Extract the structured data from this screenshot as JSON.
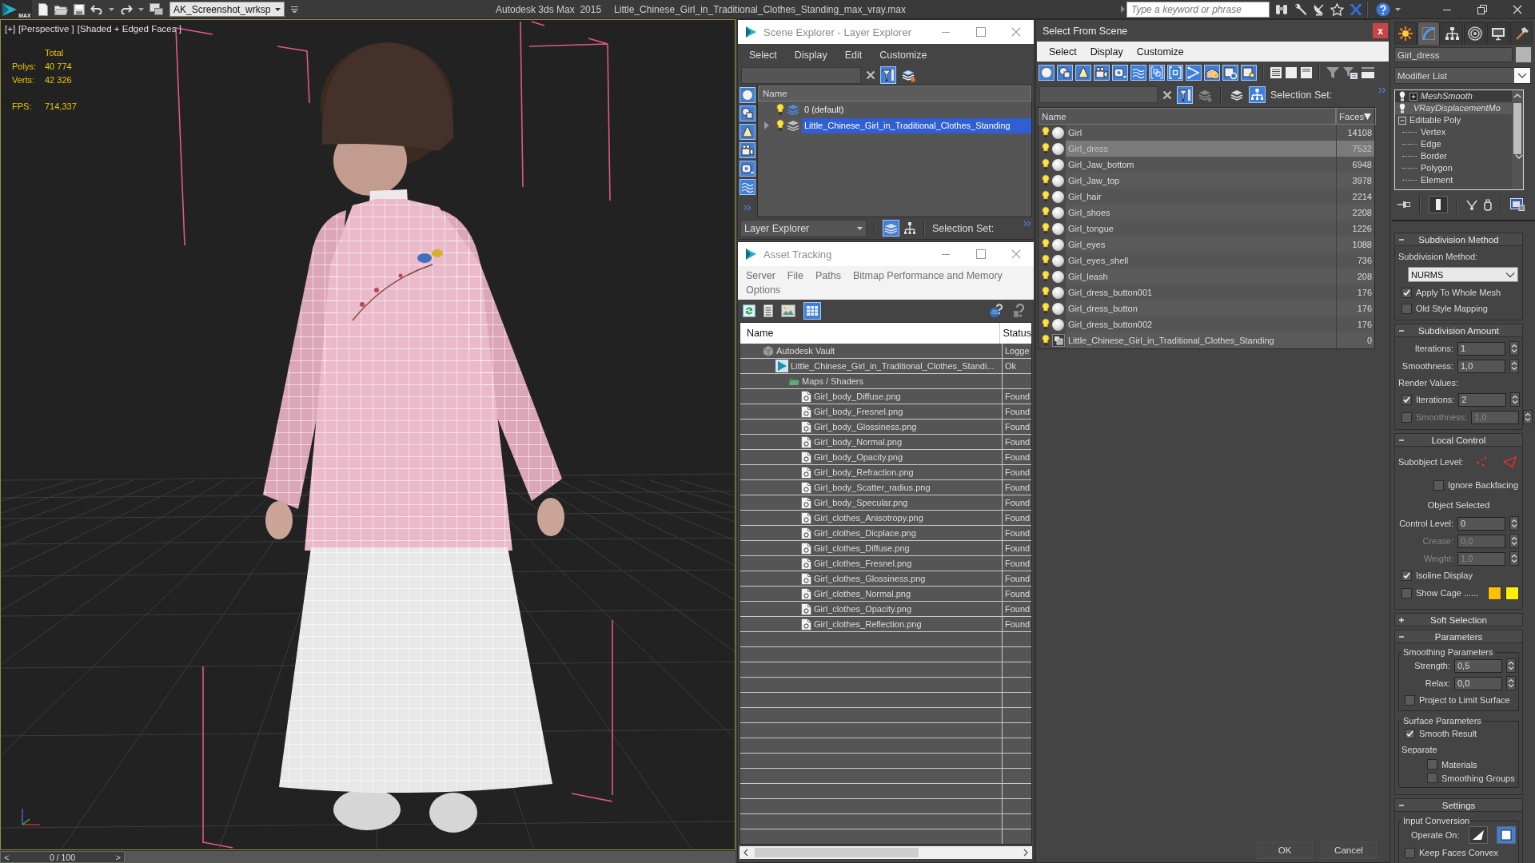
{
  "app_bar": {
    "logo": "MAX",
    "workspace": "AK_Screenshot_wrksp",
    "title": "Autodesk 3ds Max  2015",
    "file": "Little_Chinese_Girl_in_Traditional_Clothes_Standing_max_vray.max",
    "search": {
      "placeholder": "Type a keyword or phrase"
    }
  },
  "viewport": {
    "labels": [
      "[+]",
      "[Perspective ]",
      "[Shaded + Edged Faces ]"
    ],
    "stats_heading": "Total",
    "stats": [
      {
        "label": "Polys:",
        "value": "40 774"
      },
      {
        "label": "Verts:",
        "value": "42 326"
      },
      {
        "label": "FPS:",
        "value": "714,337"
      }
    ]
  },
  "time_slider": {
    "previous": "<",
    "position": "0 / 100",
    "next": ">",
    "level": 0
  },
  "scene_explorer": {
    "title": "Scene Explorer - Layer Explorer",
    "menu": [
      "Select",
      "Display",
      "Edit",
      "Customize"
    ],
    "type_filters": [
      {
        "kind": "sphere",
        "on": true
      },
      {
        "kind": "shapes",
        "on": true
      },
      {
        "kind": "spotlight",
        "on": true
      },
      {
        "kind": "camera",
        "on": true
      },
      {
        "kind": "tape",
        "on": true
      },
      {
        "kind": "waves",
        "on": true
      }
    ],
    "column": "Name",
    "layers": [
      {
        "name": "0 (default)",
        "current": true,
        "expandable": false,
        "selected": false
      },
      {
        "name": "Little_Chinese_Girl_in_Traditional_Clothes_Standing",
        "current": false,
        "expandable": true,
        "selected": true
      }
    ],
    "explorer": "Layer Explorer",
    "selection_set": "Selection Set:"
  },
  "asset_tracking": {
    "title": "Asset Tracking",
    "menu": [
      "Server",
      "File",
      "Paths",
      "Bitmap Performance and Memory",
      "Options"
    ],
    "columns": [
      "Name",
      "Status"
    ],
    "tree": [
      {
        "kind": "vault",
        "name": "Autodesk Vault",
        "status": "Logge",
        "children": [
          {
            "kind": "scene",
            "name": "Little_Chinese_Girl_in_Traditional_Clothes_Standi...",
            "status": "Ok",
            "children": [
              {
                "kind": "folder",
                "name": "Maps / Shaders",
                "children": [
                  {
                    "kind": "bitmap",
                    "name": "Girl_body_Diffuse.png",
                    "status": "Found"
                  },
                  {
                    "kind": "bitmap",
                    "name": "Girl_body_Fresnel.png",
                    "status": "Found"
                  },
                  {
                    "kind": "bitmap",
                    "name": "Girl_body_Glossiness.png",
                    "status": "Found"
                  },
                  {
                    "kind": "bitmap",
                    "name": "Girl_body_Normal.png",
                    "status": "Found"
                  },
                  {
                    "kind": "bitmap",
                    "name": "Girl_body_Opacity.png",
                    "status": "Found"
                  },
                  {
                    "kind": "bitmap",
                    "name": "Girl_body_Refraction.png",
                    "status": "Found"
                  },
                  {
                    "kind": "bitmap",
                    "name": "Girl_body_Scatter_radius.png",
                    "status": "Found"
                  },
                  {
                    "kind": "bitmap",
                    "name": "Girl_body_Specular.png",
                    "status": "Found"
                  },
                  {
                    "kind": "bitmap",
                    "name": "Girl_clothes_Anisotropy.png",
                    "status": "Found"
                  },
                  {
                    "kind": "bitmap",
                    "name": "Girl_clothes_Dicplace.png",
                    "status": "Found"
                  },
                  {
                    "kind": "bitmap",
                    "name": "Girl_clothes_Diffuse.png",
                    "status": "Found"
                  },
                  {
                    "kind": "bitmap",
                    "name": "Girl_clothes_Fresnel.png",
                    "status": "Found"
                  },
                  {
                    "kind": "bitmap",
                    "name": "Girl_clothes_Glossiness.png",
                    "status": "Found"
                  },
                  {
                    "kind": "bitmap",
                    "name": "Girl_clothes_Normal.png",
                    "status": "Found"
                  },
                  {
                    "kind": "bitmap",
                    "name": "Girl_clothes_Opacity.png",
                    "status": "Found"
                  },
                  {
                    "kind": "bitmap",
                    "name": "Girl_clothes_Reflection.png",
                    "status": "Found"
                  }
                ]
              }
            ]
          }
        ]
      }
    ]
  },
  "select_from_scene": {
    "title": "Select From Scene",
    "close": "x",
    "menu": [
      "Select",
      "Display",
      "Customize"
    ],
    "type_filters": [
      {
        "kind": "sphere",
        "on": true
      },
      {
        "kind": "shapes",
        "on": true
      },
      {
        "kind": "spotlight",
        "on": true
      },
      {
        "kind": "camera",
        "on": true
      },
      {
        "kind": "tape",
        "on": true
      },
      {
        "kind": "waves",
        "on": true
      },
      {
        "kind": "squares",
        "on": true
      },
      {
        "kind": "bracket",
        "on": true
      },
      {
        "kind": "bone",
        "on": true
      },
      {
        "kind": "box_sun",
        "on": true
      },
      {
        "kind": "box_gear",
        "on": true
      },
      {
        "kind": "box_bulb",
        "on": true
      }
    ],
    "selection_set": "Selection Set:",
    "columns": [
      "Name",
      "Faces"
    ],
    "objects": [
      {
        "kind": "geometry",
        "name": "Girl",
        "faces": "14108",
        "selected": false
      },
      {
        "kind": "geometry",
        "name": "Girl_dress",
        "faces": "7532",
        "selected": true
      },
      {
        "kind": "geometry",
        "name": "Girl_Jaw_bottom",
        "faces": "6948",
        "selected": false
      },
      {
        "kind": "geometry",
        "name": "Girl_Jaw_top",
        "faces": "3978",
        "selected": false
      },
      {
        "kind": "geometry",
        "name": "Girl_hair",
        "faces": "2214",
        "selected": false
      },
      {
        "kind": "geometry",
        "name": "Girl_shoes",
        "faces": "2208",
        "selected": false
      },
      {
        "kind": "geometry",
        "name": "Girl_tongue",
        "faces": "1226",
        "selected": false
      },
      {
        "kind": "geometry",
        "name": "Girl_eyes",
        "faces": "1088",
        "selected": false
      },
      {
        "kind": "geometry",
        "name": "Girl_eyes_shell",
        "faces": "736",
        "selected": false
      },
      {
        "kind": "geometry",
        "name": "Girl_leash",
        "faces": "208",
        "selected": false
      },
      {
        "kind": "geometry",
        "name": "Girl_dress_button001",
        "faces": "176",
        "selected": false
      },
      {
        "kind": "geometry",
        "name": "Girl_dress_button",
        "faces": "176",
        "selected": false
      },
      {
        "kind": "geometry",
        "name": "Girl_dress_button002",
        "faces": "176",
        "selected": false
      },
      {
        "kind": "group",
        "name": "Little_Chinese_Girl_in_Traditional_Clothes_Standing",
        "faces": "0",
        "selected": false
      }
    ],
    "buttons": [
      "OK",
      "Cancel"
    ]
  },
  "command_panel": {
    "tabs": [
      {
        "kind": "create",
        "selected": false
      },
      {
        "kind": "modify",
        "selected": true
      },
      {
        "kind": "hierarchy",
        "selected": false
      },
      {
        "kind": "motion",
        "selected": false
      },
      {
        "kind": "display",
        "selected": false
      },
      {
        "kind": "utilities",
        "selected": false
      }
    ],
    "object_name": "Girl_dress",
    "modifier_list": "Modifier List",
    "stack": [
      {
        "kind": "modifier",
        "name": "MeshSmooth",
        "selected": true,
        "expanded": false
      },
      {
        "kind": "modifier",
        "name": "VRayDisplacementMo",
        "selected": false
      },
      {
        "kind": "base",
        "name": "Editable Poly",
        "selected": false,
        "expanded": true,
        "children": [
          {
            "name": "Vertex"
          },
          {
            "name": "Edge"
          },
          {
            "name": "Border"
          },
          {
            "name": "Polygon"
          },
          {
            "name": "Element"
          }
        ]
      }
    ],
    "rollouts": [
      {
        "title": "Subdivision Method",
        "expanded": true,
        "controls": [
          {
            "kind": "label",
            "text": "Subdivision Method:"
          },
          {
            "kind": "dropdown",
            "value": "NURMS"
          },
          {
            "kind": "checkbox",
            "label": "Apply To Whole Mesh",
            "checked": true
          },
          {
            "kind": "checkbox",
            "label": "Old Style Mapping",
            "checked": false
          }
        ]
      },
      {
        "title": "Subdivision Amount",
        "expanded": true,
        "controls": [
          {
            "kind": "spinner",
            "label": "Iterations:",
            "value": "1",
            "disabled": false
          },
          {
            "kind": "spinner",
            "label": "Smoothness:",
            "value": "1,0",
            "disabled": false
          },
          {
            "kind": "label",
            "text": "Render Values:"
          },
          {
            "kind": "check_spinner",
            "checked": true,
            "label": "Iterations:",
            "value": "2",
            "disabled": false
          },
          {
            "kind": "check_spinner",
            "checked": false,
            "label": "Smoothness:",
            "value": "1,0",
            "disabled": true
          }
        ]
      },
      {
        "title": "Local Control",
        "expanded": true,
        "controls": [
          {
            "kind": "subobject",
            "label": "Subobject Level:"
          },
          {
            "kind": "indented_checkbox",
            "label": "Ignore Backfacing",
            "checked": false
          },
          {
            "kind": "note",
            "text": "Object Selected"
          },
          {
            "kind": "spinner",
            "label": "Control Level:",
            "value": "0",
            "disabled": false
          },
          {
            "kind": "spinner",
            "label": "Crease:",
            "value": "0,0",
            "disabled": true
          },
          {
            "kind": "spinner",
            "label": "Weight:",
            "value": "1,0",
            "disabled": true
          },
          {
            "kind": "checkbox",
            "label": "Isoline Display",
            "checked": true
          },
          {
            "kind": "cage",
            "label": "Show Cage ......",
            "checked": false,
            "swatches": [
              {
                "color": "#ffc000"
              },
              {
                "color": "#fff000"
              }
            ]
          }
        ]
      },
      {
        "title": "Soft Selection",
        "expanded": false
      },
      {
        "title": "Parameters",
        "expanded": true,
        "controls": [
          {
            "kind": "group",
            "title": "Smoothing Parameters",
            "controls": [
              {
                "kind": "spinner",
                "label": "Strength:",
                "value": "0,5",
                "disabled": false
              },
              {
                "kind": "spinner",
                "label": "Relax:",
                "value": "0,0",
                "disabled": false
              },
              {
                "kind": "checkbox",
                "label": "Project to Limit Surface",
                "checked": false
              }
            ]
          },
          {
            "kind": "group",
            "title": "Surface Parameters",
            "controls": [
              {
                "kind": "checkbox",
                "label": "Smooth Result",
                "checked": true
              },
              {
                "kind": "label",
                "text": "Separate",
                "children": [
                  {
                    "kind": "checkbox",
                    "label": "Materials",
                    "checked": false
                  },
                  {
                    "kind": "checkbox",
                    "label": "Smoothing Groups",
                    "checked": false
                  }
                ]
              }
            ]
          }
        ]
      },
      {
        "title": "Settings",
        "expanded": true,
        "controls": [
          {
            "kind": "group",
            "title": "Input Conversion",
            "controls": [
              {
                "kind": "operate_on",
                "label": "Operate On:",
                "options": [
                  {
                    "kind": "triangle",
                    "selected": false
                  },
                  {
                    "kind": "polygon",
                    "selected": true
                  }
                ]
              },
              {
                "kind": "checkbox",
                "label": "Keep Faces Convex",
                "checked": false
              }
            ]
          }
        ]
      }
    ]
  }
}
